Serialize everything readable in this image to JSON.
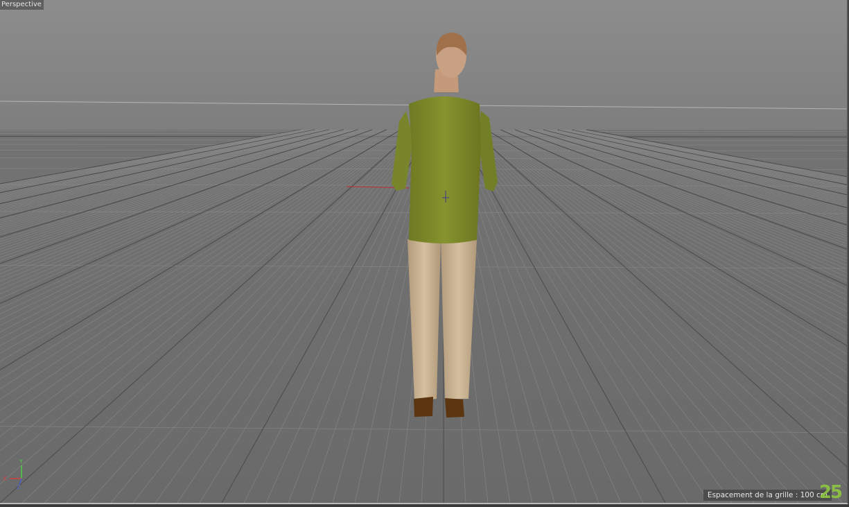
{
  "viewport": {
    "label": "Perspective",
    "grid_spacing_text": "Espacement de la grille : 100 cm",
    "logo_text": "25"
  },
  "axes": {
    "x": "X",
    "y": "Y",
    "z": "Z"
  },
  "colors": {
    "shirt": "#7f8c2a",
    "pants": "#c9b394",
    "shoes": "#5a3510",
    "sky": "#878787",
    "ground": "#6d6d6d",
    "logo": "#8dc63f"
  }
}
